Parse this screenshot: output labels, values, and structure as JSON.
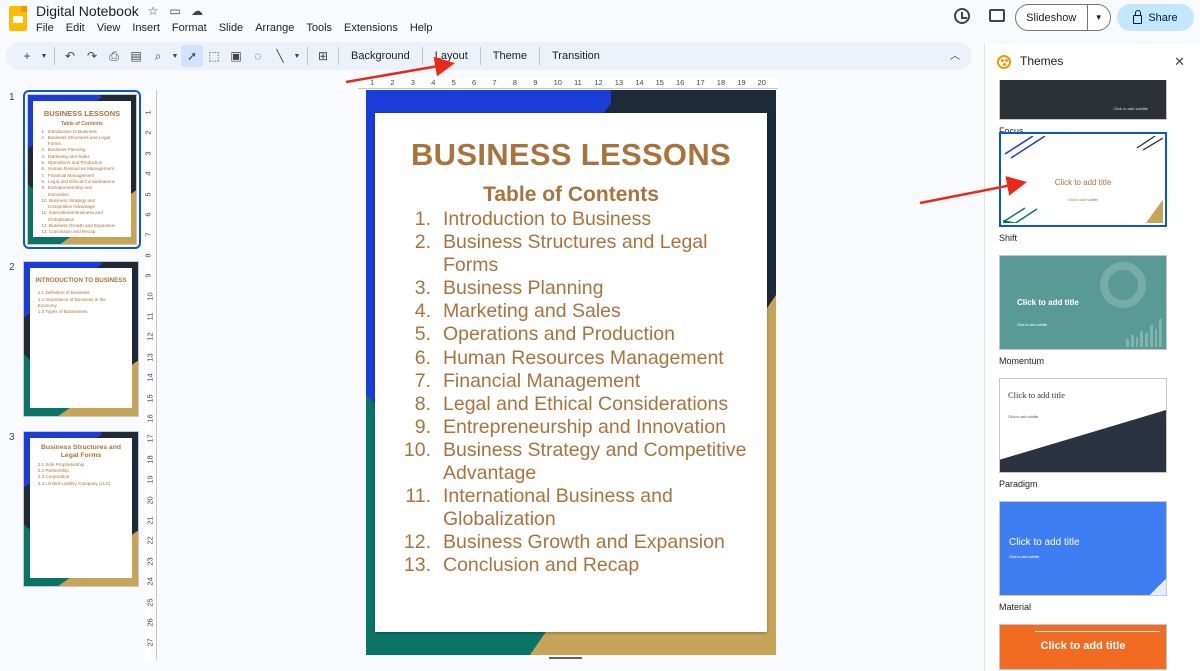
{
  "app": {
    "doc_title": "Digital Notebook",
    "menu": [
      "File",
      "Edit",
      "View",
      "Insert",
      "Format",
      "Slide",
      "Arrange",
      "Tools",
      "Extensions",
      "Help"
    ],
    "slideshow_label": "Slideshow",
    "share_label": "Share"
  },
  "toolbar": {
    "background_label": "Background",
    "layout_label": "Layout",
    "theme_label": "Theme",
    "transition_label": "Transition"
  },
  "ruler": {
    "h_ticks": [
      "1",
      "2",
      "3",
      "4",
      "5",
      "6",
      "7",
      "8",
      "9",
      "10",
      "11",
      "12",
      "13",
      "14",
      "15",
      "16",
      "17",
      "18",
      "19",
      "20"
    ],
    "v_ticks": [
      "1",
      "2",
      "3",
      "4",
      "5",
      "6",
      "7",
      "8",
      "9",
      "10",
      "11",
      "12",
      "13",
      "14",
      "15",
      "16",
      "17",
      "18",
      "19",
      "20",
      "21",
      "22",
      "23",
      "24",
      "25",
      "26",
      "27"
    ]
  },
  "filmstrip": [
    {
      "number": "1",
      "title": "BUSINESS LESSONS",
      "subtitle": "Table of Contents",
      "items": [
        "1.  Introduction to Business",
        "2.  Business Structures and Legal",
        "     Forms",
        "3.  Business Planning",
        "4.  Marketing and Sales",
        "5.  Operations and Production",
        "6.  Human Resources Management",
        "7.  Financial Management",
        "8.  Legal and Ethical Considerations",
        "9.  Entrepreneurship and",
        "     Innovation",
        "10. Business Strategy and",
        "     Competitive Advantage",
        "11. International Business and",
        "     Globalization",
        "12. Business Growth and Expansion",
        "13. Conclusion and Recap"
      ]
    },
    {
      "number": "2",
      "title": "INTRODUCTION TO BUSINESS",
      "subtitle": "",
      "items": [
        "1.1 Definition of Business",
        "1.2 Importance of Business in the",
        "Economy",
        "1.3 Types of Businesses"
      ]
    },
    {
      "number": "3",
      "title": "Business Structures and Legal Forms",
      "subtitle": "",
      "items": [
        "2.1 Sole Proprietorship",
        "2.2 Partnership",
        "2.3 Corporation",
        "2.4 Limited Liability Company (LLC)"
      ]
    }
  ],
  "slide": {
    "title": "BUSINESS LESSONS",
    "subtitle": "Table of Contents",
    "items": [
      {
        "num": "1.",
        "text": "Introduction to Business"
      },
      {
        "num": "2.",
        "text": "Business Structures and Legal Forms"
      },
      {
        "num": "3.",
        "text": "Business Planning"
      },
      {
        "num": "4.",
        "text": "Marketing and Sales"
      },
      {
        "num": "5.",
        "text": "Operations and Production"
      },
      {
        "num": "6.",
        "text": "Human Resources Management"
      },
      {
        "num": "7.",
        "text": "Financial Management"
      },
      {
        "num": "8.",
        "text": "Legal and Ethical Considerations"
      },
      {
        "num": "9.",
        "text": "Entrepreneurship and Innovation"
      },
      {
        "num": "10.",
        "text": "Business Strategy and Competitive Advantage"
      },
      {
        "num": "11.",
        "text": "International Business and Globalization"
      },
      {
        "num": "12.",
        "text": "Business Growth and Expansion"
      },
      {
        "num": "13.",
        "text": "Conclusion and Recap"
      }
    ],
    "colors": {
      "accent_text": "#a9743c",
      "blue": "#1b3cd8",
      "green": "#0a7567",
      "gold": "#c6a558",
      "dark": "#1f2a38"
    }
  },
  "themes_panel": {
    "title": "Themes",
    "themes": [
      {
        "name": "Focus",
        "sample_title": "",
        "sample_subtitle": "Click to add subtitle"
      },
      {
        "name": "Shift",
        "sample_title": "Click to add title",
        "sample_subtitle": "Click to add subtitle"
      },
      {
        "name": "Momentum",
        "sample_title": "Click to add title",
        "sample_subtitle": "Click to add subtitle"
      },
      {
        "name": "Paradigm",
        "sample_title": "Click to add title",
        "sample_subtitle": "Click to add subtitle"
      },
      {
        "name": "Material",
        "sample_title": "Click to add title",
        "sample_subtitle": "Click to add subtitle"
      },
      {
        "name": "",
        "sample_title": "Click to add title",
        "sample_subtitle": ""
      }
    ]
  },
  "icons": [
    "star-icon",
    "folder-icon",
    "cloud-icon",
    "history-icon",
    "comment-icon",
    "lock-icon",
    "palette-icon",
    "close-icon"
  ]
}
